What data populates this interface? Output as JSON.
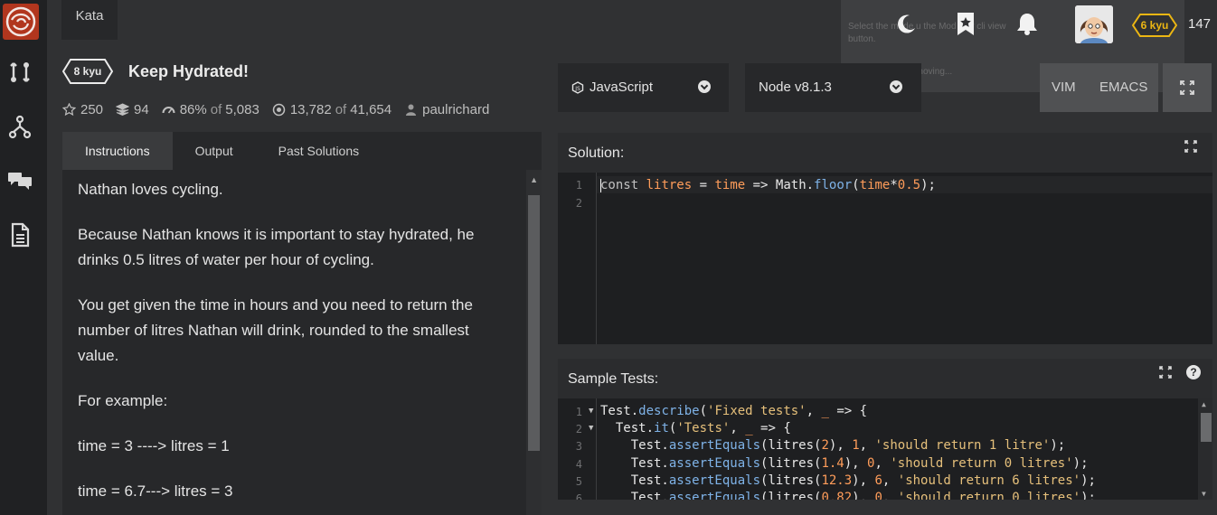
{
  "nav": {
    "kata_tab": "Kata"
  },
  "overlay": {
    "line1": "Select the         mode u      the Mod    n or cli       view",
    "line2": "button.",
    "line3": "Snipping Tool is moving..."
  },
  "topbar": {
    "rank": "6 kyu",
    "honor": "147"
  },
  "kata": {
    "kyu": "8 kyu",
    "title": "Keep Hydrated!",
    "stats": {
      "stars": "250",
      "collections": "94",
      "satisfaction_pct": "86%",
      "of_word": "of",
      "satisfaction_votes": "5,083",
      "completed": "13,782",
      "attempted": "41,654",
      "author": "paulrichard"
    }
  },
  "instructions": {
    "tabs": [
      "Instructions",
      "Output",
      "Past Solutions"
    ],
    "paragraphs": [
      "Nathan loves cycling.",
      "Because Nathan knows it is important to stay hydrated, he drinks 0.5 litres of water per hour of cycling.",
      "You get given the time in hours and you need to return the number of litres Nathan will drink, rounded to the smallest value.",
      "For example:",
      "time = 3 ----> litres = 1",
      "time = 6.7---> litres = 3"
    ]
  },
  "editor": {
    "language": "JavaScript",
    "version": "Node v8.1.3",
    "vim": "VIM",
    "emacs": "EMACS",
    "solution_title": "Solution:",
    "solution_lines": [
      "1",
      "2"
    ],
    "tests_title": "Sample Tests:",
    "help_label": "?",
    "test_lines": [
      "1",
      "2",
      "3",
      "4",
      "5",
      "6"
    ]
  },
  "colors": {
    "brand": "#b1361e",
    "rank_yellow": "#ecb613",
    "background": "#303133",
    "panel": "#27282a"
  }
}
